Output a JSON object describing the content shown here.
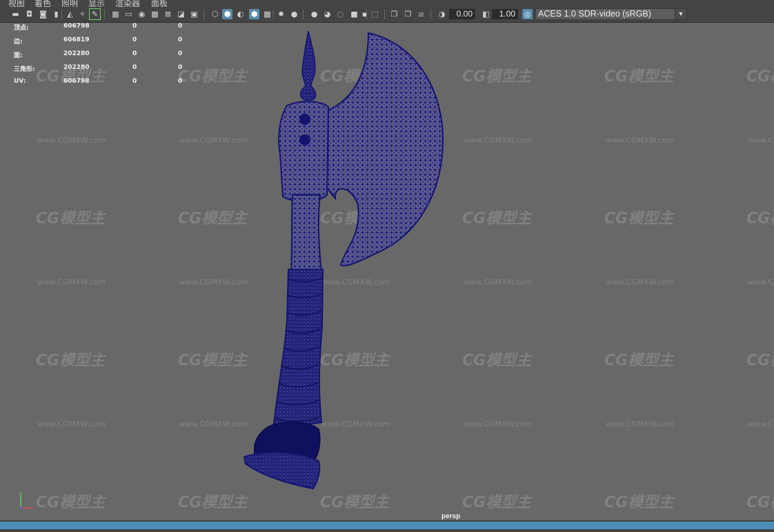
{
  "menu": {
    "items": [
      {
        "label": "视图"
      },
      {
        "label": "着色"
      },
      {
        "label": "照明"
      },
      {
        "label": "显示"
      },
      {
        "label": "渲染器"
      },
      {
        "label": "面板"
      }
    ]
  },
  "toolbar": {
    "exposure_value": "0.00",
    "gamma_value": "1.00",
    "color_management_label": "ACES 1.0 SDR-video (sRGB)",
    "icons": [
      "camera-select-icon",
      "camera-attributes-icon",
      "bookmark-icon",
      "image-plane-icon",
      "2d-pan-zoom-icon",
      "grease-pencil-icon",
      "grid-icon",
      "film-gate-icon",
      "resolution-gate-icon",
      "gate-mask-icon",
      "field-chart-icon",
      "safe-action-icon",
      "safe-title-icon",
      "wireframe-icon",
      "smooth-shade-icon",
      "default-material-icon",
      "wireframe-on-shaded-icon",
      "textured-icon",
      "lights-icon",
      "shadows-icon",
      "screen-space-ao-icon",
      "motion-blur-icon",
      "anti-aliasing-icon",
      "depth-of-field-icon",
      "isolate-select-icon",
      "xray-icon",
      "xray-joints-icon",
      "xray-components-icon",
      "exposure-icon",
      "gamma-icon",
      "color-management-icon"
    ]
  },
  "hud": {
    "rows": [
      {
        "label": "顶点:",
        "v1": "606798",
        "v2": "0",
        "v3": "0"
      },
      {
        "label": "边:",
        "v1": "606819",
        "v2": "0",
        "v3": "0"
      },
      {
        "label": "面:",
        "v1": "202280",
        "v2": "0",
        "v3": "0"
      },
      {
        "label": "三角形:",
        "v1": "202280",
        "v2": "0",
        "v3": "0"
      },
      {
        "label": "UV:",
        "v1": "606798",
        "v2": "0",
        "v3": "0"
      }
    ]
  },
  "viewport": {
    "camera": "persp",
    "axis_y": "y",
    "axis_x": "x",
    "wireframe_color": "#1a1a80"
  },
  "watermark": {
    "logo_text": "CG模型主",
    "url_text": "www.CGMXW.com"
  }
}
